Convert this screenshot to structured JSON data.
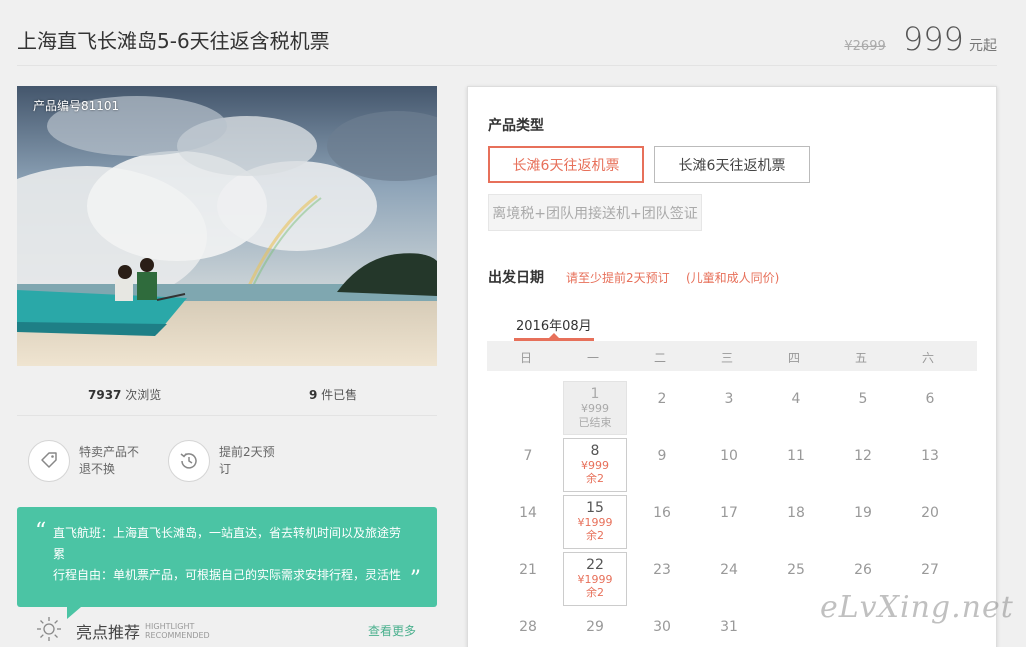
{
  "header": {
    "title": "上海直飞长滩岛5-6天往返含税机票",
    "old_price": "¥2699",
    "price": "999",
    "price_unit": "元起"
  },
  "gallery": {
    "product_code": "产品编号81101"
  },
  "stats": {
    "views_count": "7937",
    "views_label": " 次浏览",
    "sold_count": "9",
    "sold_label": " 件已售"
  },
  "features": [
    {
      "icon": "tag-icon",
      "text": "特卖产品不退不换"
    },
    {
      "icon": "history-icon",
      "text": "提前2天预订"
    }
  ],
  "quote": {
    "open_mark": "“",
    "close_mark": "”",
    "line1": "直飞航班：上海直飞长滩岛，一站直达，省去转机时间以及旅途劳累",
    "line2": "行程自由：单机票产品，可根据自己的实际需求安排行程，灵活性"
  },
  "highlights": {
    "title": "亮点推荐",
    "sub1": "HIGHTLIGHT",
    "sub2": "RECOMMENDED",
    "more": "查看更多"
  },
  "booking": {
    "type_label": "产品类型",
    "options": [
      {
        "label": "长滩6天往返机票",
        "selected": true
      },
      {
        "label": "长滩6天往返机票",
        "selected": false
      },
      {
        "label": "离境税+团队用接送机+团队签证",
        "disabled": true
      }
    ],
    "date_label": "出发日期",
    "note1": "请至少提前2天预订",
    "note2": "(儿童和成人同价)",
    "month": "2016年08月",
    "weekdays": [
      "日",
      "一",
      "二",
      "三",
      "四",
      "五",
      "六"
    ]
  },
  "calendar": {
    "rows": [
      [
        {
          "d": ""
        },
        {
          "d": "1",
          "price": "¥999",
          "status": "已结束",
          "ended": true
        },
        {
          "d": "2"
        },
        {
          "d": "3"
        },
        {
          "d": "4"
        },
        {
          "d": "5"
        },
        {
          "d": "6"
        }
      ],
      [
        {
          "d": "7"
        },
        {
          "d": "8",
          "price": "¥999",
          "status": "余2"
        },
        {
          "d": "9"
        },
        {
          "d": "10"
        },
        {
          "d": "11"
        },
        {
          "d": "12"
        },
        {
          "d": "13"
        }
      ],
      [
        {
          "d": "14"
        },
        {
          "d": "15",
          "price": "¥1999",
          "status": "余2"
        },
        {
          "d": "16"
        },
        {
          "d": "17"
        },
        {
          "d": "18"
        },
        {
          "d": "19"
        },
        {
          "d": "20"
        }
      ],
      [
        {
          "d": "21"
        },
        {
          "d": "22",
          "price": "¥1999",
          "status": "余2"
        },
        {
          "d": "23"
        },
        {
          "d": "24"
        },
        {
          "d": "25"
        },
        {
          "d": "26"
        },
        {
          "d": "27"
        }
      ],
      [
        {
          "d": "28"
        },
        {
          "d": "29"
        },
        {
          "d": "30"
        },
        {
          "d": "31"
        },
        {
          "d": ""
        },
        {
          "d": ""
        },
        {
          "d": ""
        }
      ]
    ]
  },
  "watermark": "eLvXing.net",
  "colors": {
    "accent": "#e7705a",
    "green": "#4bc4a4"
  }
}
